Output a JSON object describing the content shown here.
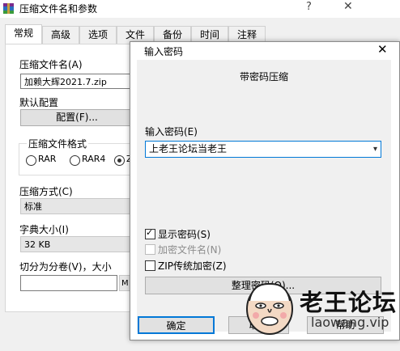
{
  "background_window": {
    "title": "压缩文件名和参数",
    "help_glyph": "?",
    "close_glyph": "✕",
    "tabs": [
      {
        "label": "常规",
        "active": true
      },
      {
        "label": "高级",
        "active": false
      },
      {
        "label": "选项",
        "active": false
      },
      {
        "label": "文件",
        "active": false
      },
      {
        "label": "备份",
        "active": false
      },
      {
        "label": "时间",
        "active": false
      },
      {
        "label": "注释",
        "active": false
      }
    ],
    "archive_name_label": "压缩文件名(A)",
    "archive_name_value": "加赖大辉2021.7.zip",
    "default_profile_label": "默认配置",
    "profile_button": "配置(F)...",
    "format_group_label": "压缩文件格式",
    "format_options": [
      {
        "label": "RAR",
        "selected": false
      },
      {
        "label": "RAR4",
        "selected": false
      },
      {
        "label": "Z",
        "selected": true
      }
    ],
    "method_label": "压缩方式(C)",
    "method_value": "标准",
    "dict_label": "字典大小(I)",
    "dict_value": "32 KB",
    "split_label": "切分为分卷(V)，大小",
    "split_unit_partial": "M"
  },
  "dialog": {
    "title": "输入密码",
    "close_glyph": "✕",
    "heading": "带密码压缩",
    "password_label": "输入密码(E)",
    "password_value": "上老王论坛当老王",
    "checkboxes": [
      {
        "label": "显示密码(S)",
        "checked": true,
        "enabled": true
      },
      {
        "label": "加密文件名(N)",
        "checked": false,
        "enabled": false
      },
      {
        "label": "ZIP传统加密(Z)",
        "checked": false,
        "enabled": true
      }
    ],
    "organize_button": "整理密码(O)...",
    "ok_button": "确定",
    "cancel_button": "取消",
    "help_button": "帮助"
  },
  "watermark": {
    "text": "老王论坛",
    "url": "laowang.vip"
  },
  "colors": {
    "window_bg": "#f0f0f0",
    "focus_blue": "#0078d7",
    "button_gray": "#e1e1e1"
  }
}
